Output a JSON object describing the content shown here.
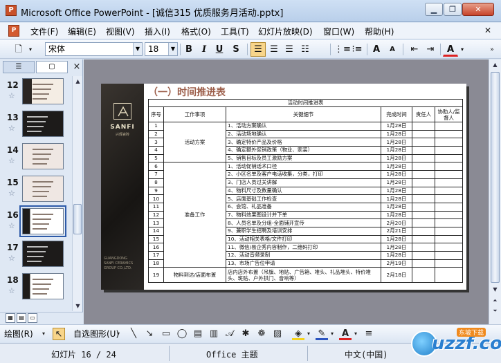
{
  "window": {
    "title": "Microsoft Office PowerPoint - [诚信315 优质服务月活动.pptx]",
    "app_icon": "powerpoint-icon",
    "buttons": [
      "minimize",
      "restore",
      "close"
    ]
  },
  "menubar": {
    "items": [
      "文件(F)",
      "编辑(E)",
      "视图(V)",
      "插入(I)",
      "格式(O)",
      "工具(T)",
      "幻灯片放映(D)",
      "窗口(W)",
      "帮助(H)"
    ],
    "right_close": "✕"
  },
  "toolbar": {
    "font_name": "宋体",
    "font_size": "18",
    "bold": "B",
    "italic": "I",
    "underline": "U",
    "shadow": "S",
    "increase_font": "A",
    "decrease_font": "A",
    "font_color": "A"
  },
  "slides_pane": {
    "tab_outline": "outline-icon",
    "tab_slides": "slides-icon",
    "close": "×",
    "thumbnails": [
      {
        "num": "12"
      },
      {
        "num": "13"
      },
      {
        "num": "14"
      },
      {
        "num": "15"
      },
      {
        "num": "16",
        "selected": true
      },
      {
        "num": "17"
      },
      {
        "num": "18"
      }
    ]
  },
  "slide": {
    "logo_text": "SANFI",
    "logo_sub": "兴辉瓷砖",
    "bottom_text": [
      "GUANGDONG",
      "SANFI CERAMICS",
      "GROUP CO.,LTD."
    ],
    "heading": "（一）时间推进表",
    "table": {
      "caption": "活动时间推进表",
      "headers": [
        "序号",
        "工作事项",
        "关键细节",
        "完成时间",
        "责任人",
        "协助人/监督人"
      ],
      "groups": [
        {
          "name": "活动方案",
          "rows": [
            [
              "1",
              "1、活动方案确认",
              "1月28日"
            ],
            [
              "2",
              "2、活动场地确认",
              "1月28日"
            ],
            [
              "3",
              "3、确定特价产品及价格",
              "1月28日"
            ],
            [
              "4",
              "4、确定额外促销政策（物业、家装）",
              "1月28日"
            ],
            [
              "5",
              "5、销售目标及员工激励方案",
              "1月28日"
            ]
          ]
        },
        {
          "name": "准备工作",
          "rows": [
            [
              "6",
              "1、活动促销话术口径",
              "1月28日"
            ],
            [
              "7",
              "2、小区名单及客户电话收集，分类，打印",
              "1月28日"
            ],
            [
              "8",
              "3、门店人员过关讲解",
              "1月28日"
            ],
            [
              "9",
              "4、物料尺寸及数量确认",
              "1月28日"
            ],
            [
              "10",
              "5、店面基础工作检查",
              "1月28日"
            ],
            [
              "11",
              "6、会馆、礼品准备",
              "1月28日"
            ],
            [
              "12",
              "7、物料效果图设计并下单",
              "1月28日"
            ],
            [
              "13",
              "8、人员名单及分组-全面铺开宣传",
              "2月20日"
            ],
            [
              "14",
              "9、兼职学生招聘及培训安排",
              "2月21日"
            ],
            [
              "15",
              "10、活动相关表格/文件打印",
              "1月28日"
            ],
            [
              "16",
              "11、微信/易企秀内容制作，二维码打印",
              "1月28日"
            ],
            [
              "17",
              "12、活动音频录制",
              "1月28日"
            ],
            [
              "18",
              "13、市场广告位申请",
              "2月19日"
            ]
          ]
        },
        {
          "name": "物料到达/店面布置",
          "rows": [
            [
              "19",
              "店内店外布置（吊旗、地贴、广告箱、堆头、礼品堆头、特价堆头、斑贴、户外拱门、音响等）",
              "2月18日"
            ]
          ]
        }
      ]
    }
  },
  "drawbar": {
    "draw_label": "绘图(R)",
    "autoshapes_label": "自选图形(U)"
  },
  "statusbar": {
    "slide_info": "幻灯片 16 / 24",
    "theme": "Office 主题",
    "language": "中文(中国)"
  },
  "watermark": {
    "text": "uzzf.com",
    "tag": "东坡下载"
  },
  "colors": {
    "heading": "#9c5e4a",
    "slide_bg": "#8a8a94",
    "title_bar": "#c3d6ee"
  }
}
